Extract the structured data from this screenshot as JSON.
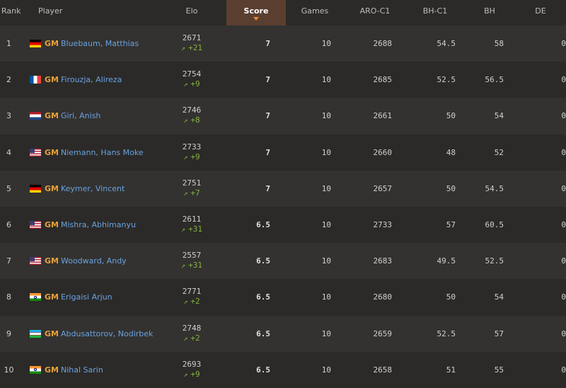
{
  "headers": {
    "rank": "Rank",
    "player": "Player",
    "elo": "Elo",
    "score": "Score",
    "games": "Games",
    "aro": "ARO-C1",
    "bhc1": "BH-C1",
    "bh": "BH",
    "de": "DE"
  },
  "colors": {
    "accent": "#e8893a",
    "title": "#e8a23a",
    "link": "#6aa2e0",
    "gain": "#85b33f"
  },
  "rows": [
    {
      "rank": "1",
      "flag": "de",
      "title": "GM",
      "name": "Bluebaum, Matthias",
      "elo": "2671",
      "delta": "+21",
      "score": "7",
      "games": "10",
      "aro": "2688",
      "bhc1": "54.5",
      "bh": "58",
      "de": "0"
    },
    {
      "rank": "2",
      "flag": "fr",
      "title": "GM",
      "name": "Firouzja, Alireza",
      "elo": "2754",
      "delta": "+9",
      "score": "7",
      "games": "10",
      "aro": "2685",
      "bhc1": "52.5",
      "bh": "56.5",
      "de": "0"
    },
    {
      "rank": "3",
      "flag": "nl",
      "title": "GM",
      "name": "Giri, Anish",
      "elo": "2746",
      "delta": "+8",
      "score": "7",
      "games": "10",
      "aro": "2661",
      "bhc1": "50",
      "bh": "54",
      "de": "0"
    },
    {
      "rank": "4",
      "flag": "us",
      "title": "GM",
      "name": "Niemann, Hans Moke",
      "elo": "2733",
      "delta": "+9",
      "score": "7",
      "games": "10",
      "aro": "2660",
      "bhc1": "48",
      "bh": "52",
      "de": "0"
    },
    {
      "rank": "5",
      "flag": "de",
      "title": "GM",
      "name": "Keymer, Vincent",
      "elo": "2751",
      "delta": "+7",
      "score": "7",
      "games": "10",
      "aro": "2657",
      "bhc1": "50",
      "bh": "54.5",
      "de": "0"
    },
    {
      "rank": "6",
      "flag": "us",
      "title": "GM",
      "name": "Mishra, Abhimanyu",
      "elo": "2611",
      "delta": "+31",
      "score": "6.5",
      "games": "10",
      "aro": "2733",
      "bhc1": "57",
      "bh": "60.5",
      "de": "0"
    },
    {
      "rank": "7",
      "flag": "us",
      "title": "GM",
      "name": "Woodward, Andy",
      "elo": "2557",
      "delta": "+31",
      "score": "6.5",
      "games": "10",
      "aro": "2683",
      "bhc1": "49.5",
      "bh": "52.5",
      "de": "0"
    },
    {
      "rank": "8",
      "flag": "in",
      "title": "GM",
      "name": "Erigaisi Arjun",
      "elo": "2771",
      "delta": "+2",
      "score": "6.5",
      "games": "10",
      "aro": "2680",
      "bhc1": "50",
      "bh": "54",
      "de": "0"
    },
    {
      "rank": "9",
      "flag": "uz",
      "title": "GM",
      "name": "Abdusattorov, Nodirbek",
      "elo": "2748",
      "delta": "+2",
      "score": "6.5",
      "games": "10",
      "aro": "2659",
      "bhc1": "52.5",
      "bh": "57",
      "de": "0"
    },
    {
      "rank": "10",
      "flag": "in",
      "title": "GM",
      "name": "Nihal Sarin",
      "elo": "2693",
      "delta": "+9",
      "score": "6.5",
      "games": "10",
      "aro": "2658",
      "bhc1": "51",
      "bh": "55",
      "de": "0"
    }
  ]
}
